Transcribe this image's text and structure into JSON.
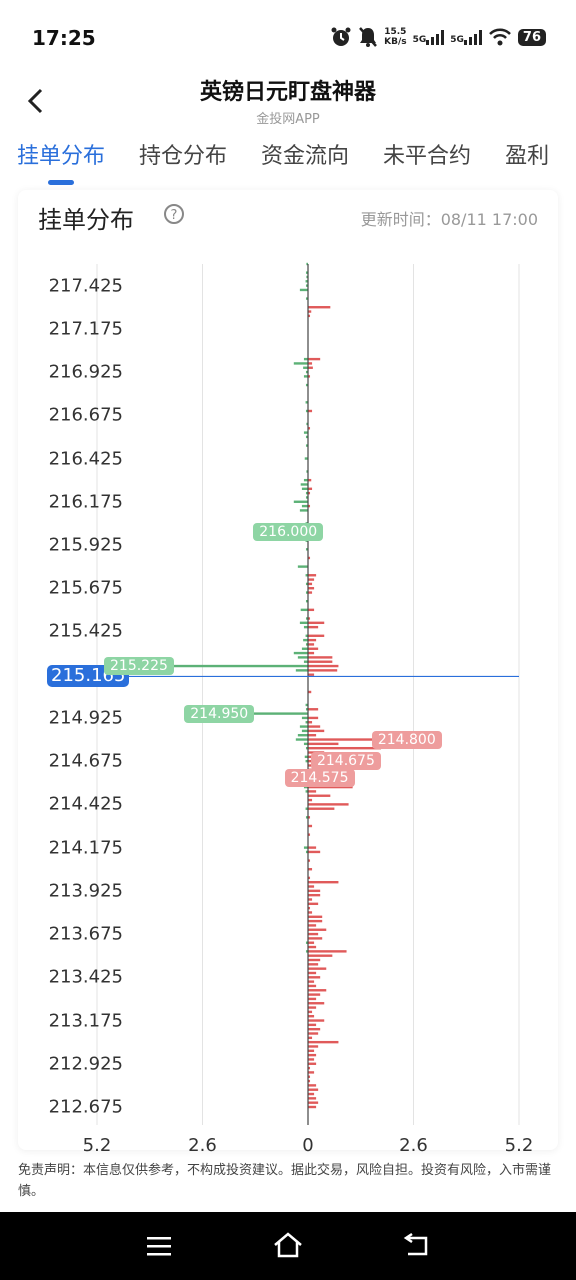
{
  "status_bar": {
    "time": "17:25",
    "net_speed_value": "15.5",
    "net_speed_unit": "KB/s",
    "signal_1": "5G",
    "signal_2": "5G",
    "battery": "76"
  },
  "header": {
    "title": "英镑日元盯盘神器",
    "subtitle": "金投网APP"
  },
  "tabs": [
    {
      "label": "挂单分布",
      "active": true
    },
    {
      "label": "持仓分布",
      "active": false
    },
    {
      "label": "资金流向",
      "active": false
    },
    {
      "label": "未平合约",
      "active": false
    },
    {
      "label": "盈利",
      "active": false
    }
  ],
  "card": {
    "title": "挂单分布",
    "update_time": "更新时间：08/11 17:00"
  },
  "chart_data": {
    "type": "bar",
    "orientation": "horizontal-diverging",
    "y_ticks": [
      "217.425",
      "217.175",
      "216.925",
      "216.675",
      "216.425",
      "216.175",
      "215.925",
      "215.675",
      "215.425",
      "214.925",
      "214.675",
      "214.425",
      "214.175",
      "213.925",
      "213.675",
      "213.425",
      "213.175",
      "212.925",
      "212.675"
    ],
    "x_ticks": [
      "5.2",
      "2.6",
      "0",
      "2.6",
      "5.2"
    ],
    "xlim": [
      -5.2,
      5.2
    ],
    "ylim": [
      212.675,
      217.55
    ],
    "current_price": "215.165",
    "series": [
      {
        "color": "#5cb176",
        "values": [
          {
            "price": 217.55,
            "v": 0.04
          },
          {
            "price": 217.5,
            "v": 0.05
          },
          {
            "price": 217.475,
            "v": 0.04
          },
          {
            "price": 217.45,
            "v": 0.06
          },
          {
            "price": 217.425,
            "v": 0.05
          },
          {
            "price": 217.4,
            "v": 0.2
          },
          {
            "price": 217.35,
            "v": 0.05
          },
          {
            "price": 217.0,
            "v": 0.1
          },
          {
            "price": 216.975,
            "v": 0.35
          },
          {
            "price": 216.95,
            "v": 0.12
          },
          {
            "price": 216.925,
            "v": 0.05
          },
          {
            "price": 216.9,
            "v": 0.1
          },
          {
            "price": 216.85,
            "v": 0.05
          },
          {
            "price": 216.75,
            "v": 0.06
          },
          {
            "price": 216.7,
            "v": 0.05
          },
          {
            "price": 216.625,
            "v": 0.04
          },
          {
            "price": 216.575,
            "v": 0.1
          },
          {
            "price": 216.55,
            "v": 0.05
          },
          {
            "price": 216.5,
            "v": 0.05
          },
          {
            "price": 216.425,
            "v": 0.08
          },
          {
            "price": 216.35,
            "v": 0.04
          },
          {
            "price": 216.3,
            "v": 0.1
          },
          {
            "price": 216.275,
            "v": 0.18
          },
          {
            "price": 216.25,
            "v": 0.15
          },
          {
            "price": 216.225,
            "v": 0.05
          },
          {
            "price": 216.2,
            "v": 0.05
          },
          {
            "price": 216.175,
            "v": 0.35
          },
          {
            "price": 216.15,
            "v": 0.15
          },
          {
            "price": 216.125,
            "v": 0.2
          },
          {
            "price": 216.05,
            "v": 0.06
          },
          {
            "price": 216.0,
            "v": 1.3
          },
          {
            "price": 215.95,
            "v": 0.06
          },
          {
            "price": 215.9,
            "v": 0.05
          },
          {
            "price": 215.8,
            "v": 0.25
          },
          {
            "price": 215.75,
            "v": 0.06
          },
          {
            "price": 215.7,
            "v": 0.05
          },
          {
            "price": 215.65,
            "v": 0.05
          },
          {
            "price": 215.6,
            "v": 0.05
          },
          {
            "price": 215.55,
            "v": 0.18
          },
          {
            "price": 215.5,
            "v": 0.05
          },
          {
            "price": 215.475,
            "v": 0.2
          },
          {
            "price": 215.45,
            "v": 0.1
          },
          {
            "price": 215.4,
            "v": 0.06
          },
          {
            "price": 215.375,
            "v": 0.12
          },
          {
            "price": 215.35,
            "v": 0.05
          },
          {
            "price": 215.325,
            "v": 0.15
          },
          {
            "price": 215.3,
            "v": 0.35
          },
          {
            "price": 215.275,
            "v": 0.25
          },
          {
            "price": 215.25,
            "v": 0.1
          },
          {
            "price": 215.225,
            "v": 5.0
          },
          {
            "price": 215.2,
            "v": 0.3
          },
          {
            "price": 215.0,
            "v": 0.06
          },
          {
            "price": 214.975,
            "v": 0.05
          },
          {
            "price": 214.95,
            "v": 3.0
          },
          {
            "price": 214.925,
            "v": 0.15
          },
          {
            "price": 214.9,
            "v": 0.06
          },
          {
            "price": 214.875,
            "v": 0.2
          },
          {
            "price": 214.85,
            "v": 0.15
          },
          {
            "price": 214.825,
            "v": 0.25
          },
          {
            "price": 214.8,
            "v": 0.3
          },
          {
            "price": 214.775,
            "v": 0.1
          },
          {
            "price": 214.75,
            "v": 0.05
          },
          {
            "price": 214.7,
            "v": 0.08
          },
          {
            "price": 214.675,
            "v": 0.06
          },
          {
            "price": 214.6,
            "v": 0.2
          },
          {
            "price": 214.575,
            "v": 0.15
          },
          {
            "price": 214.55,
            "v": 0.06
          },
          {
            "price": 214.525,
            "v": 0.1
          },
          {
            "price": 214.5,
            "v": 0.06
          },
          {
            "price": 214.4,
            "v": 0.06
          },
          {
            "price": 214.35,
            "v": 0.05
          },
          {
            "price": 214.175,
            "v": 0.1
          },
          {
            "price": 214.15,
            "v": 0.05
          },
          {
            "price": 213.625,
            "v": 0.05
          },
          {
            "price": 213.575,
            "v": 0.05
          }
        ]
      },
      {
        "color": "#e05a5a",
        "values": [
          {
            "price": 217.3,
            "v": 0.55
          },
          {
            "price": 217.275,
            "v": 0.08
          },
          {
            "price": 217.25,
            "v": 0.05
          },
          {
            "price": 217.0,
            "v": 0.3
          },
          {
            "price": 216.975,
            "v": 0.1
          },
          {
            "price": 216.95,
            "v": 0.12
          },
          {
            "price": 216.9,
            "v": 0.05
          },
          {
            "price": 216.7,
            "v": 0.1
          },
          {
            "price": 216.6,
            "v": 0.05
          },
          {
            "price": 216.3,
            "v": 0.08
          },
          {
            "price": 216.25,
            "v": 0.1
          },
          {
            "price": 216.225,
            "v": 0.05
          },
          {
            "price": 216.15,
            "v": 0.05
          },
          {
            "price": 215.85,
            "v": 0.05
          },
          {
            "price": 215.75,
            "v": 0.2
          },
          {
            "price": 215.725,
            "v": 0.15
          },
          {
            "price": 215.7,
            "v": 0.1
          },
          {
            "price": 215.675,
            "v": 0.15
          },
          {
            "price": 215.65,
            "v": 0.1
          },
          {
            "price": 215.55,
            "v": 0.15
          },
          {
            "price": 215.5,
            "v": 0.05
          },
          {
            "price": 215.475,
            "v": 0.4
          },
          {
            "price": 215.45,
            "v": 0.25
          },
          {
            "price": 215.4,
            "v": 0.4
          },
          {
            "price": 215.375,
            "v": 0.2
          },
          {
            "price": 215.35,
            "v": 0.15
          },
          {
            "price": 215.325,
            "v": 0.25
          },
          {
            "price": 215.3,
            "v": 0.15
          },
          {
            "price": 215.275,
            "v": 0.6
          },
          {
            "price": 215.25,
            "v": 0.6
          },
          {
            "price": 215.225,
            "v": 0.75
          },
          {
            "price": 215.2,
            "v": 0.72
          },
          {
            "price": 215.175,
            "v": 0.15
          },
          {
            "price": 215.075,
            "v": 0.08
          },
          {
            "price": 214.975,
            "v": 0.25
          },
          {
            "price": 214.925,
            "v": 0.25
          },
          {
            "price": 214.9,
            "v": 0.1
          },
          {
            "price": 214.875,
            "v": 0.3
          },
          {
            "price": 214.85,
            "v": 0.4
          },
          {
            "price": 214.825,
            "v": 0.2
          },
          {
            "price": 214.8,
            "v": 3.2
          },
          {
            "price": 214.775,
            "v": 0.75
          },
          {
            "price": 214.75,
            "v": 1.8
          },
          {
            "price": 214.725,
            "v": 0.4
          },
          {
            "price": 214.7,
            "v": 1.05
          },
          {
            "price": 214.675,
            "v": 1.7
          },
          {
            "price": 214.65,
            "v": 0.6
          },
          {
            "price": 214.625,
            "v": 0.75
          },
          {
            "price": 214.6,
            "v": 0.2
          },
          {
            "price": 214.575,
            "v": 1.05
          },
          {
            "price": 214.55,
            "v": 0.75
          },
          {
            "price": 214.525,
            "v": 1.1
          },
          {
            "price": 214.5,
            "v": 0.2
          },
          {
            "price": 214.475,
            "v": 0.55
          },
          {
            "price": 214.45,
            "v": 0.1
          },
          {
            "price": 214.425,
            "v": 1.0
          },
          {
            "price": 214.4,
            "v": 0.65
          },
          {
            "price": 214.35,
            "v": 0.05
          },
          {
            "price": 214.3,
            "v": 0.1
          },
          {
            "price": 214.25,
            "v": 0.05
          },
          {
            "price": 214.175,
            "v": 0.2
          },
          {
            "price": 214.15,
            "v": 0.3
          },
          {
            "price": 214.1,
            "v": 0.05
          },
          {
            "price": 214.05,
            "v": 0.1
          },
          {
            "price": 214.0,
            "v": 0.05
          },
          {
            "price": 213.975,
            "v": 0.75
          },
          {
            "price": 213.95,
            "v": 0.15
          },
          {
            "price": 213.925,
            "v": 0.3
          },
          {
            "price": 213.9,
            "v": 0.3
          },
          {
            "price": 213.875,
            "v": 0.1
          },
          {
            "price": 213.85,
            "v": 0.25
          },
          {
            "price": 213.825,
            "v": 0.05
          },
          {
            "price": 213.8,
            "v": 0.1
          },
          {
            "price": 213.775,
            "v": 0.35
          },
          {
            "price": 213.75,
            "v": 0.35
          },
          {
            "price": 213.725,
            "v": 0.2
          },
          {
            "price": 213.7,
            "v": 0.45
          },
          {
            "price": 213.675,
            "v": 0.25
          },
          {
            "price": 213.65,
            "v": 0.35
          },
          {
            "price": 213.625,
            "v": 0.15
          },
          {
            "price": 213.6,
            "v": 0.2
          },
          {
            "price": 213.575,
            "v": 0.95
          },
          {
            "price": 213.55,
            "v": 0.6
          },
          {
            "price": 213.525,
            "v": 0.3
          },
          {
            "price": 213.5,
            "v": 0.25
          },
          {
            "price": 213.475,
            "v": 0.45
          },
          {
            "price": 213.45,
            "v": 0.2
          },
          {
            "price": 213.425,
            "v": 0.3
          },
          {
            "price": 213.4,
            "v": 0.15
          },
          {
            "price": 213.375,
            "v": 0.2
          },
          {
            "price": 213.35,
            "v": 0.45
          },
          {
            "price": 213.325,
            "v": 0.3
          },
          {
            "price": 213.3,
            "v": 0.2
          },
          {
            "price": 213.275,
            "v": 0.4
          },
          {
            "price": 213.25,
            "v": 0.2
          },
          {
            "price": 213.225,
            "v": 0.1
          },
          {
            "price": 213.2,
            "v": 0.15
          },
          {
            "price": 213.175,
            "v": 0.4
          },
          {
            "price": 213.15,
            "v": 0.2
          },
          {
            "price": 213.125,
            "v": 0.3
          },
          {
            "price": 213.1,
            "v": 0.25
          },
          {
            "price": 213.075,
            "v": 0.1
          },
          {
            "price": 213.05,
            "v": 0.75
          },
          {
            "price": 213.025,
            "v": 0.25
          },
          {
            "price": 213.0,
            "v": 0.15
          },
          {
            "price": 212.975,
            "v": 0.2
          },
          {
            "price": 212.95,
            "v": 0.15
          },
          {
            "price": 212.925,
            "v": 0.2
          },
          {
            "price": 212.9,
            "v": 0.05
          },
          {
            "price": 212.875,
            "v": 0.15
          },
          {
            "price": 212.85,
            "v": 0.05
          },
          {
            "price": 212.825,
            "v": 0.05
          },
          {
            "price": 212.8,
            "v": 0.2
          },
          {
            "price": 212.775,
            "v": 0.25
          },
          {
            "price": 212.75,
            "v": 0.15
          },
          {
            "price": 212.725,
            "v": 0.2
          },
          {
            "price": 212.7,
            "v": 0.25
          },
          {
            "price": 212.675,
            "v": 0.2
          }
        ]
      }
    ],
    "annotations": [
      {
        "label": "216.000",
        "price": 216.0,
        "side": "left",
        "color": "g"
      },
      {
        "label": "215.225",
        "price": 215.225,
        "side": "left",
        "color": "g"
      },
      {
        "label": "214.950",
        "price": 214.95,
        "side": "left",
        "color": "g"
      },
      {
        "label": "214.800",
        "price": 214.8,
        "side": "right",
        "color": "r"
      },
      {
        "label": "214.675",
        "price": 214.675,
        "side": "right",
        "color": "r"
      },
      {
        "label": "214.575",
        "price": 214.575,
        "side": "right",
        "color": "r"
      }
    ]
  },
  "disclaimer": "免责声明：本信息仅供参考，不构成投资建议。据此交易，风险自担。投资有风险，入市需谨慎。"
}
